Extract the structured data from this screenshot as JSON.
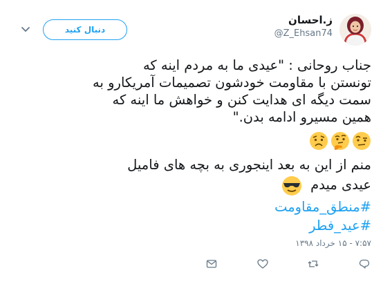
{
  "header": {
    "display_name": "ز.احسان",
    "handle": "@Z_Ehsan74",
    "follow_label": "دنبال کنید"
  },
  "tweet": {
    "lines": [
      "جناب روحانی : \"عیدی ما به مردم اینه که",
      "تونستن با مقاومت خودشون تصمیمات آمریکارو به",
      "سمت دیگه ای هدایت کنن و خواهش ما اینه که",
      "همین مسیرو ادامه بدن.\""
    ],
    "emojis": [
      "face-with-raised-eyebrow-emoji",
      "thinking-face-emoji",
      "worried-face-emoji"
    ],
    "line5": "منم از این به بعد اینجوری به بچه های فامیل",
    "line6": "عیدی میدم",
    "line6_emoji": "smiling-face-with-sunglasses-emoji",
    "hashtags": [
      "#منطق_مقاومت",
      "#عید_فطر"
    ],
    "timestamp": "۷:۵۷ - ۱۵ خرداد ۱۳۹۸"
  },
  "actions": [
    "reply-icon",
    "retweet-icon",
    "like-icon",
    "message-icon"
  ],
  "colors": {
    "accent": "#1da1f2",
    "muted": "#657786",
    "text": "#14171a"
  }
}
